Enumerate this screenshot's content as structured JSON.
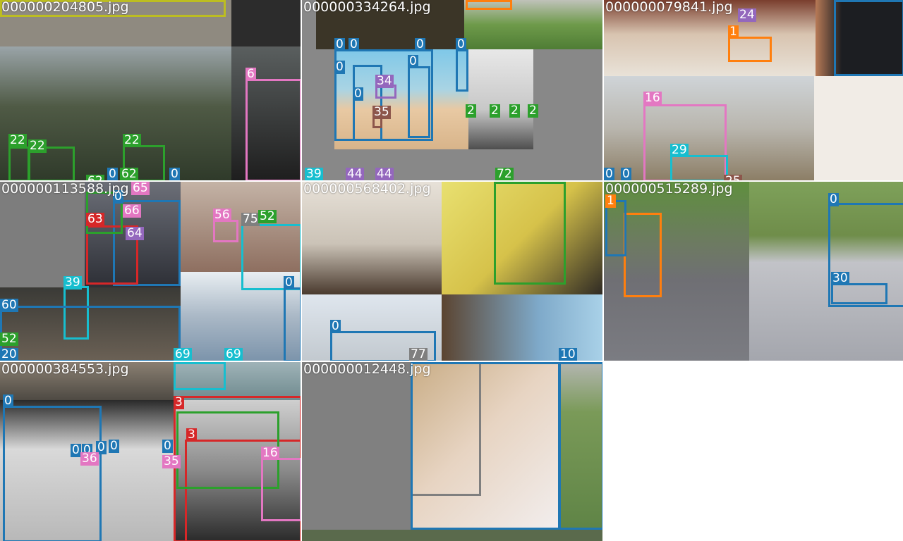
{
  "mosaic": {
    "tiles": [
      {
        "filename": "000000204805.jpg",
        "labels": [
          {
            "text": "6",
            "color": "#e377c2"
          },
          {
            "text": "22",
            "color": "#2ca02c"
          },
          {
            "text": "22",
            "color": "#2ca02c"
          },
          {
            "text": "22",
            "color": "#2ca02c"
          },
          {
            "text": "62",
            "color": "#2ca02c"
          },
          {
            "text": "62",
            "color": "#2ca02c"
          },
          {
            "text": "0",
            "color": "#1f77b4"
          },
          {
            "text": "0",
            "color": "#1f77b4"
          }
        ]
      },
      {
        "filename": "000000334264.jpg",
        "labels": [
          {
            "text": "0",
            "color": "#1f77b4"
          },
          {
            "text": "0",
            "color": "#1f77b4"
          },
          {
            "text": "0",
            "color": "#1f77b4"
          },
          {
            "text": "0",
            "color": "#1f77b4"
          },
          {
            "text": "0",
            "color": "#1f77b4"
          },
          {
            "text": "0",
            "color": "#1f77b4"
          },
          {
            "text": "0",
            "color": "#1f77b4"
          },
          {
            "text": "34",
            "color": "#9467bd"
          },
          {
            "text": "35",
            "color": "#8c564b"
          },
          {
            "text": "2",
            "color": "#2ca02c"
          },
          {
            "text": "2",
            "color": "#2ca02c"
          },
          {
            "text": "2",
            "color": "#2ca02c"
          },
          {
            "text": "2",
            "color": "#2ca02c"
          },
          {
            "text": "39",
            "color": "#17becf"
          },
          {
            "text": "44",
            "color": "#9467bd"
          },
          {
            "text": "44",
            "color": "#9467bd"
          },
          {
            "text": "72",
            "color": "#2ca02c"
          }
        ]
      },
      {
        "filename": "000000079841.jpg",
        "labels": [
          {
            "text": "24",
            "color": "#9467bd"
          },
          {
            "text": "1",
            "color": "#ff7f0e"
          },
          {
            "text": "16",
            "color": "#e377c2"
          },
          {
            "text": "29",
            "color": "#17becf"
          },
          {
            "text": "0",
            "color": "#1f77b4"
          },
          {
            "text": "0",
            "color": "#1f77b4"
          },
          {
            "text": "25",
            "color": "#8c564b"
          }
        ]
      },
      {
        "filename": "000000113588.jpg",
        "labels": [
          {
            "text": "65",
            "color": "#e377c2"
          },
          {
            "text": "0",
            "color": "#1f77b4"
          },
          {
            "text": "66",
            "color": "#e377c2"
          },
          {
            "text": "63",
            "color": "#d62728"
          },
          {
            "text": "64",
            "color": "#9467bd"
          },
          {
            "text": "56",
            "color": "#e377c2"
          },
          {
            "text": "75",
            "color": "#7f7f7f"
          },
          {
            "text": "52",
            "color": "#2ca02c"
          },
          {
            "text": "0",
            "color": "#1f77b4"
          },
          {
            "text": "39",
            "color": "#17becf"
          },
          {
            "text": "60",
            "color": "#1f77b4"
          },
          {
            "text": "52",
            "color": "#2ca02c"
          },
          {
            "text": "20",
            "color": "#1f77b4"
          },
          {
            "text": "69",
            "color": "#17becf"
          },
          {
            "text": "69",
            "color": "#17becf"
          }
        ]
      },
      {
        "filename": "000000568402.jpg",
        "labels": [
          {
            "text": "0",
            "color": "#1f77b4"
          },
          {
            "text": "77",
            "color": "#7f7f7f"
          },
          {
            "text": "10",
            "color": "#1f77b4"
          }
        ]
      },
      {
        "filename": "000000515289.jpg",
        "labels": [
          {
            "text": "1",
            "color": "#ff7f0e"
          },
          {
            "text": "0",
            "color": "#1f77b4"
          },
          {
            "text": "30",
            "color": "#1f77b4"
          }
        ]
      },
      {
        "filename": "000000384553.jpg",
        "labels": [
          {
            "text": "0",
            "color": "#1f77b4"
          },
          {
            "text": "0",
            "color": "#1f77b4"
          },
          {
            "text": "0",
            "color": "#1f77b4"
          },
          {
            "text": "0",
            "color": "#1f77b4"
          },
          {
            "text": "0",
            "color": "#1f77b4"
          },
          {
            "text": "36",
            "color": "#e377c2"
          },
          {
            "text": "0",
            "color": "#1f77b4"
          },
          {
            "text": "35",
            "color": "#e377c2"
          },
          {
            "text": "3",
            "color": "#d62728"
          },
          {
            "text": "3",
            "color": "#d62728"
          },
          {
            "text": "16",
            "color": "#e377c2"
          }
        ]
      },
      {
        "filename": "000000012448.jpg",
        "labels": []
      }
    ]
  }
}
